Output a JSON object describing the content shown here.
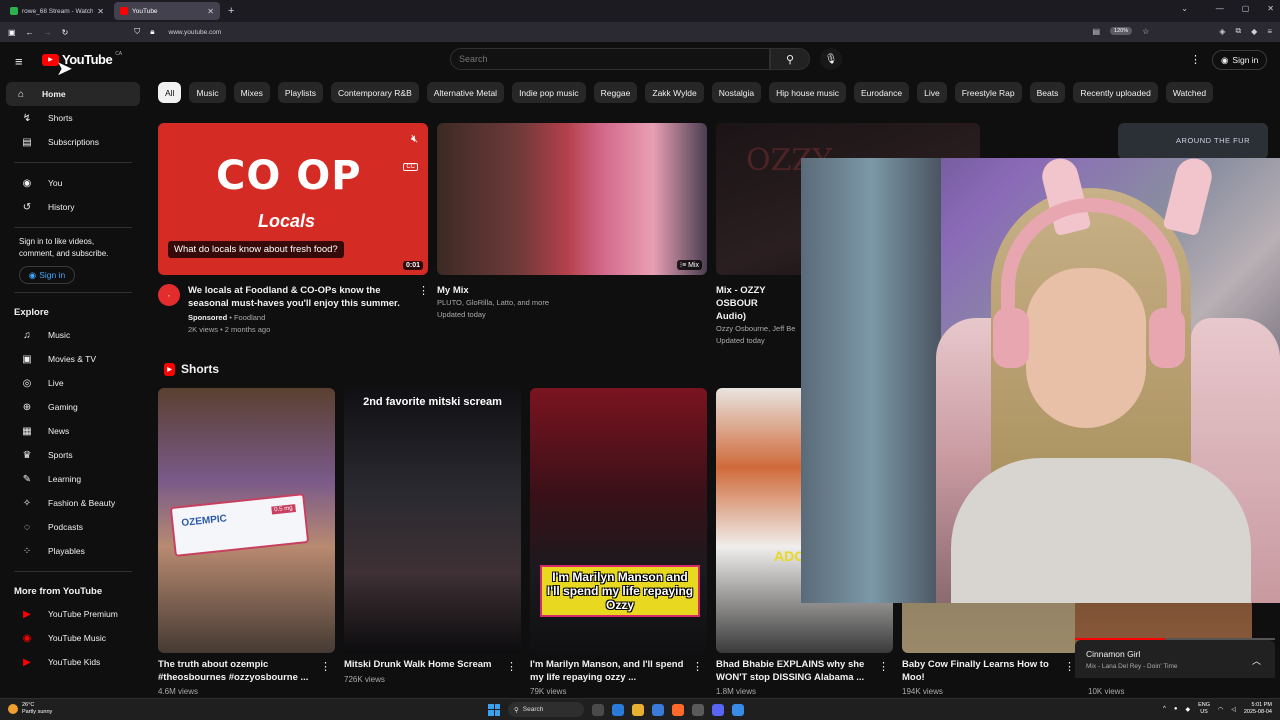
{
  "browser": {
    "tabs": [
      {
        "title": "rowe_68 Stream - Watch Live o",
        "color": "#2bb24c"
      },
      {
        "title": "YouTube",
        "color": "#ff0000"
      }
    ],
    "url": "www.youtube.com",
    "zoom": "120%"
  },
  "header": {
    "logo_text": "YouTube",
    "region": "CA",
    "search_placeholder": "Search",
    "signin_label": "Sign in"
  },
  "sidebar": {
    "primary": [
      {
        "label": "Home",
        "icon": "home-icon",
        "glyph": "⌂"
      },
      {
        "label": "Shorts",
        "icon": "shorts-icon",
        "glyph": "↯"
      },
      {
        "label": "Subscriptions",
        "icon": "subscriptions-icon",
        "glyph": "▤"
      }
    ],
    "you": [
      {
        "label": "You",
        "icon": "you-icon",
        "glyph": "◉"
      },
      {
        "label": "History",
        "icon": "history-icon",
        "glyph": "↺"
      }
    ],
    "signin_prompt": "Sign in to like videos, comment, and subscribe.",
    "signin_button": "Sign in",
    "explore_title": "Explore",
    "explore": [
      {
        "label": "Music",
        "icon": "music-icon",
        "glyph": "♫"
      },
      {
        "label": "Movies & TV",
        "icon": "movies-icon",
        "glyph": "▣"
      },
      {
        "label": "Live",
        "icon": "live-icon",
        "glyph": "◎"
      },
      {
        "label": "Gaming",
        "icon": "gaming-icon",
        "glyph": "⊕"
      },
      {
        "label": "News",
        "icon": "news-icon",
        "glyph": "▦"
      },
      {
        "label": "Sports",
        "icon": "sports-icon",
        "glyph": "♛"
      },
      {
        "label": "Learning",
        "icon": "learning-icon",
        "glyph": "✎"
      },
      {
        "label": "Fashion & Beauty",
        "icon": "fashion-icon",
        "glyph": "✧"
      },
      {
        "label": "Podcasts",
        "icon": "podcasts-icon",
        "glyph": "◌"
      },
      {
        "label": "Playables",
        "icon": "playables-icon",
        "glyph": "⁘"
      }
    ],
    "more_title": "More from YouTube",
    "more": [
      {
        "label": "YouTube Premium",
        "icon": "youtube-premium-icon",
        "glyph": "▶"
      },
      {
        "label": "YouTube Music",
        "icon": "youtube-music-icon",
        "glyph": "◉"
      },
      {
        "label": "YouTube Kids",
        "icon": "youtube-kids-icon",
        "glyph": "▶"
      }
    ]
  },
  "chips": [
    "All",
    "Music",
    "Mixes",
    "Playlists",
    "Contemporary R&B",
    "Alternative Metal",
    "Indie pop music",
    "Reggae",
    "Zakk Wylde",
    "Nostalgia",
    "Hip house music",
    "Eurodance",
    "Live",
    "Freestyle Rap",
    "Beats",
    "Recently uploaded",
    "Watched"
  ],
  "videos": {
    "ad": {
      "thumb_logo": "CO OP",
      "thumb_text": "Locals",
      "question": "What do locals know about fresh food?",
      "duration": "0:01",
      "title": "We locals at Foodland & CO-OPs know the seasonal must-haves you'll enjoy this summer.",
      "sponsored": "Sponsored",
      "channel": "Foodland",
      "stats": "2K views • 2 months ago"
    },
    "mix": {
      "badge": "Mix",
      "title": "My Mix",
      "artists": "PLUTO, GloRilla, Latto, and more",
      "updated": "Updated today"
    },
    "ozzy": {
      "thumb_word": "OZZY",
      "title": "Mix - OZZY OSBOUR",
      "title2": "Audio)",
      "artists": "Ozzy Osbourne, Jeff Be",
      "updated": "Updated today"
    },
    "far": {
      "label": "AROUND THE FUR"
    }
  },
  "shorts": {
    "title": "Shorts",
    "items": [
      {
        "title": "The truth about ozempic #theosbournes #ozzyosbourne ...",
        "views": "4.6M views",
        "caption": "OZEMPIC"
      },
      {
        "title": "Mitski Drunk Walk Home Scream",
        "views": "726K views",
        "caption": "2nd favorite mitski scream"
      },
      {
        "title": "I'm Marilyn Manson, and I'll spend my life repaying ozzy ...",
        "views": "79K views",
        "caption": "I'm Marilyn Manson and I'll spend my life repaying Ozzy"
      },
      {
        "title": "Bhad Bhabie EXPLAINS why she WON'T stop DISSING Alabama ...",
        "views": "1.8M views",
        "caption": "ADO"
      },
      {
        "title": "Baby Cow Finally Learns How to Moo!",
        "views": "194K views"
      },
      {
        "views": "10K views"
      }
    ]
  },
  "now_playing": {
    "title": "Cinnamon Girl",
    "subtitle": "Mix - Lana Del Rey - Doin' Time",
    "progress": 0.45
  },
  "taskbar": {
    "temp": "26°C",
    "weather": "Partly sunny",
    "search": "Search",
    "lang1": "ENG",
    "lang2": "US",
    "time": "5:01 PM",
    "date": "2025-08-04"
  }
}
